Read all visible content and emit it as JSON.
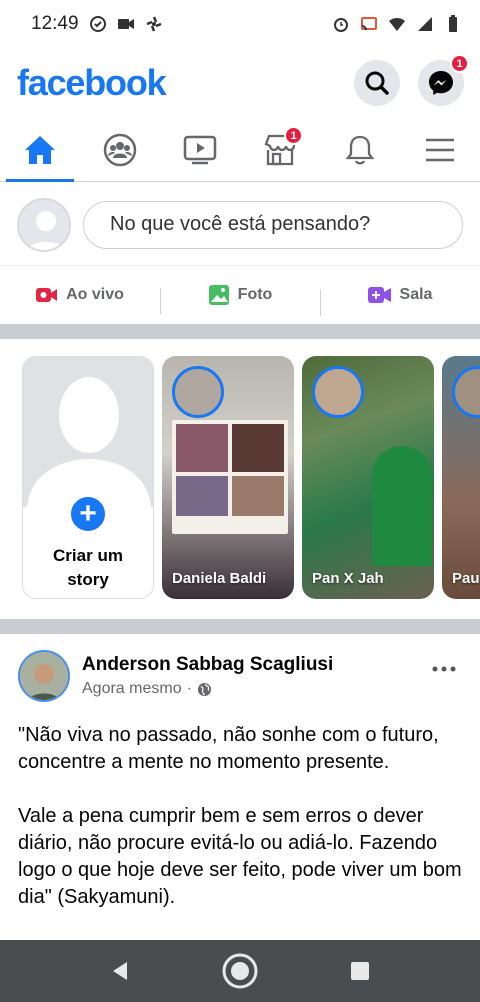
{
  "status_bar": {
    "time": "12:49"
  },
  "header": {
    "logo": "facebook",
    "messenger_badge": "1"
  },
  "tabs": [
    {
      "name": "home",
      "active": true
    },
    {
      "name": "groups",
      "active": false
    },
    {
      "name": "watch",
      "active": false
    },
    {
      "name": "marketplace",
      "active": false,
      "badge": "1"
    },
    {
      "name": "notifications",
      "active": false
    },
    {
      "name": "menu",
      "active": false
    }
  ],
  "composer": {
    "placeholder": "No que você está pensando?"
  },
  "composer_actions": [
    {
      "label": "Ao vivo",
      "icon": "live-video-icon",
      "color": "#e42645"
    },
    {
      "label": "Foto",
      "icon": "photo-icon",
      "color": "#45bd62"
    },
    {
      "label": "Sala",
      "icon": "room-icon",
      "color": "#8c51e7"
    }
  ],
  "stories": {
    "create_label_1": "Criar um",
    "create_label_2": "story",
    "items": [
      {
        "name": "Daniela Baldi"
      },
      {
        "name": "Pan X Jah"
      },
      {
        "name": "Pau"
      }
    ]
  },
  "post": {
    "author": "Anderson Sabbag Scagliusi",
    "time": "Agora mesmo",
    "paragraph_1": "\"Não viva no passado, não sonhe com o futuro, concentre a mente no momento presente.",
    "paragraph_2": "Vale a pena cumprir bem e sem erros o dever diário, não procure evitá-lo ou adiá-lo. Fazendo logo o que hoje deve ser feito, pode viver um bom dia\" (Sakyamuni)."
  },
  "colors": {
    "brand": "#1877f2",
    "badge": "#e41e3f"
  }
}
